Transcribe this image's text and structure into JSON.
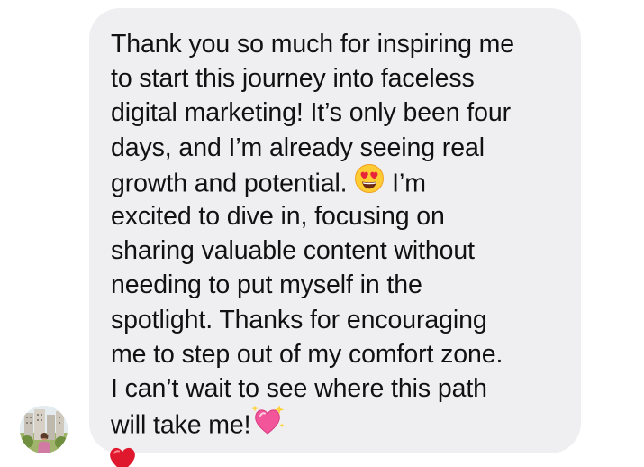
{
  "message": {
    "lines": [
      "Thank you so much for inspiring me",
      "to start this journey into faceless",
      "digital marketing! It’s only been four",
      "days, and I’m already seeing real",
      {
        "before": "growth and potential. ",
        "emoji": "heart-eyes-emoji",
        "after": " I’m"
      },
      "excited to dive in, focusing on",
      "sharing valuable content without",
      "needing to put myself in the",
      "spotlight. Thanks for encouraging",
      "me to step out of my comfort zone.",
      "I can’t wait to see where this path",
      {
        "before": "will take me!",
        "emoji": "sparkling-heart-emoji"
      }
    ],
    "reaction": "red-heart-emoji"
  },
  "sender": {
    "avatar": "avatar"
  },
  "colors": {
    "bubble": "#efeff1",
    "text": "#111111",
    "heart": "#e0182d"
  }
}
